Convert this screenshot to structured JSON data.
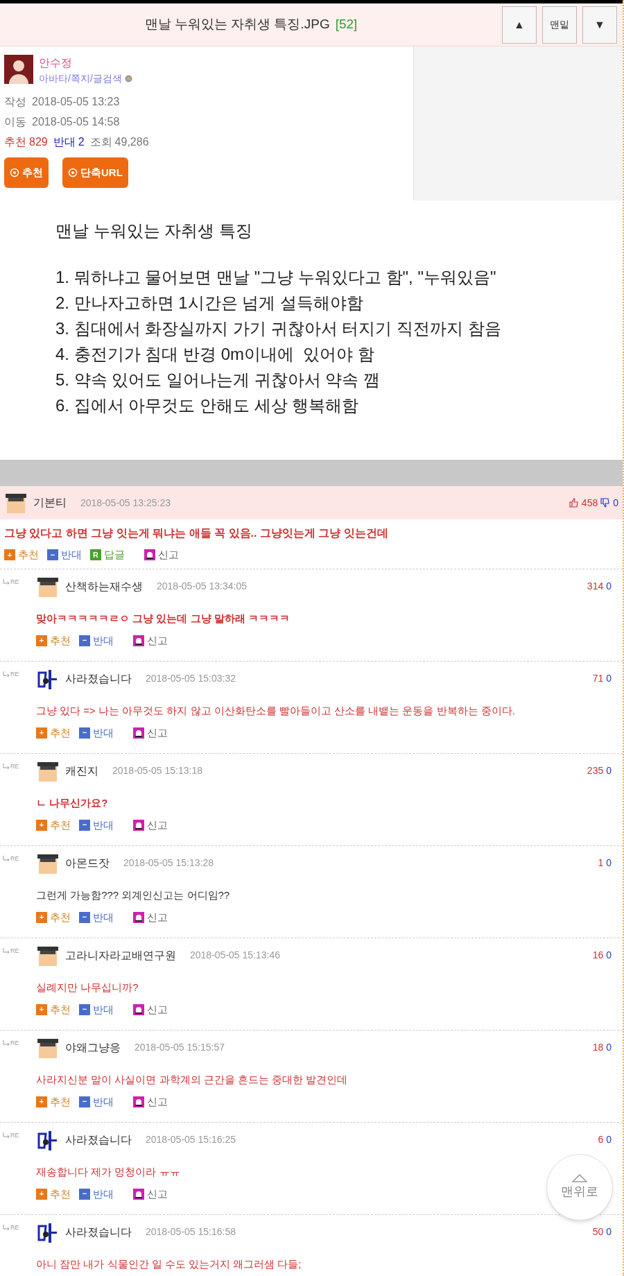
{
  "header": {
    "title": "맨날 누워있는 자취생 특징.JPG",
    "count": "[52]",
    "buttons": [
      {
        "kind": "glyph",
        "label": "▲"
      },
      {
        "kind": "text",
        "label": "맨밑"
      },
      {
        "kind": "glyph",
        "label": "▼"
      }
    ]
  },
  "post": {
    "author": "안수정",
    "author_links": "아바타/쪽지/글검색",
    "meta": [
      {
        "label": "작성",
        "value": "2018-05-05 13:23"
      },
      {
        "label": "이동",
        "value": "2018-05-05 14:58"
      }
    ],
    "stats": [
      {
        "kind": "up",
        "label": "추천",
        "value": "829"
      },
      {
        "kind": "down",
        "label": "반대",
        "value": "2"
      },
      {
        "kind": "plain",
        "label": "조회",
        "value": "49,286"
      }
    ],
    "buttons": [
      "추천",
      "단축URL"
    ],
    "body_title": "맨날 누워있는 자취생 특징",
    "body_lines": [
      "1. 뭐하냐고 물어보면 맨날 \"그냥 누워있다고 함\", \"누워있음\"",
      "2. 만나자고하면 1시간은 넘게 설득해야함",
      "3. 침대에서 화장실까지 가기 귀찮아서 터지기 직전까지 참음",
      "4. 충전기가 침대 반경 0m이내에  있어야 함",
      "5. 약속 있어도 일어나는게 귀찮아서 약속 깸",
      "6. 집에서 아무것도 안해도 세상 행복해함"
    ]
  },
  "best_comment": {
    "user": "기본티",
    "avatar": {
      "kind": "pixel"
    },
    "time": "2018-05-05 13:25:23",
    "up": "458",
    "down": "0",
    "text": "그냥 있다고 하면 그냥 잇는게 뭐냐는 애들 꼭 있음.. 그냥잇는게 그냥 잇는건데",
    "kind": "bold",
    "actions": [
      {
        "kind": "recommend",
        "glyph": "+",
        "label": "추천"
      },
      {
        "kind": "oppose",
        "glyph": "−",
        "label": "반대"
      },
      {
        "kind": "reply",
        "glyph": "R",
        "label": "답글"
      },
      {
        "kind": "report",
        "label": "신고"
      }
    ]
  },
  "replies": [
    {
      "marker": "RE",
      "user": "산책하는재수생",
      "avatar": {
        "kind": "pixel"
      },
      "time": "2018-05-05 13:34:05",
      "up": "314",
      "down": "0",
      "text": "맞아ㅋㅋㅋㅋㅋㄹㅇ 그냥 있는데 그냥 말하래 ㅋㅋㅋㅋ",
      "kind": "bold",
      "actions": [
        {
          "kind": "recommend",
          "glyph": "+",
          "label": "추천"
        },
        {
          "kind": "oppose",
          "glyph": "−",
          "label": "반대"
        },
        {
          "kind": "report",
          "label": "신고"
        }
      ]
    },
    {
      "marker": "RE",
      "user": "사라졌습니다",
      "avatar": {
        "kind": "emblem"
      },
      "time": "2018-05-05 15:03:32",
      "up": "71",
      "down": "0",
      "text": "그냥 있다 => 나는 아무것도 하지 않고 이산화탄소를 빨아들이고 산소를 내뱉는 운동을 반복하는 중이다.",
      "kind": "normal",
      "actions": [
        {
          "kind": "recommend",
          "glyph": "+",
          "label": "추천"
        },
        {
          "kind": "oppose",
          "glyph": "−",
          "label": "반대"
        },
        {
          "kind": "report",
          "label": "신고"
        }
      ]
    },
    {
      "marker": "RE",
      "user": "캐진지",
      "avatar": {
        "kind": "pixel"
      },
      "time": "2018-05-05 15:13:18",
      "up": "235",
      "down": "0",
      "text": "ㄴ 나무신가요?",
      "kind": "bold",
      "actions": [
        {
          "kind": "recommend",
          "glyph": "+",
          "label": "추천"
        },
        {
          "kind": "oppose",
          "glyph": "−",
          "label": "반대"
        },
        {
          "kind": "report",
          "label": "신고"
        }
      ]
    },
    {
      "marker": "RE",
      "user": "아몬드잣",
      "avatar": {
        "kind": "pixel"
      },
      "time": "2018-05-05 15:13:28",
      "up": "1",
      "down": "0",
      "text": "그런게 가능함??? 외계인신고는 어디임??",
      "kind": "plain",
      "actions": [
        {
          "kind": "recommend",
          "glyph": "+",
          "label": "추천"
        },
        {
          "kind": "oppose",
          "glyph": "−",
          "label": "반대"
        },
        {
          "kind": "report",
          "label": "신고"
        }
      ]
    },
    {
      "marker": "RE",
      "user": "고라니자라교배연구원",
      "avatar": {
        "kind": "pixel"
      },
      "time": "2018-05-05 15:13:46",
      "up": "16",
      "down": "0",
      "text": "실례지만 나무십니까?",
      "kind": "normal",
      "actions": [
        {
          "kind": "recommend",
          "glyph": "+",
          "label": "추천"
        },
        {
          "kind": "oppose",
          "glyph": "−",
          "label": "반대"
        },
        {
          "kind": "report",
          "label": "신고"
        }
      ]
    },
    {
      "marker": "RE",
      "user": "야왜그냥응",
      "avatar": {
        "kind": "pixel"
      },
      "time": "2018-05-05 15:15:57",
      "up": "18",
      "down": "0",
      "text": "사라지신분 말이 사실이면 과학계의 근간을 흔드는 중대한 발견인데",
      "kind": "normal",
      "actions": [
        {
          "kind": "recommend",
          "glyph": "+",
          "label": "추천"
        },
        {
          "kind": "oppose",
          "glyph": "−",
          "label": "반대"
        },
        {
          "kind": "report",
          "label": "신고"
        }
      ]
    },
    {
      "marker": "RE",
      "user": "사라졌습니다",
      "avatar": {
        "kind": "emblem"
      },
      "time": "2018-05-05 15:16:25",
      "up": "6",
      "down": "0",
      "text": "재송합니다 제가 멍청이라 ㅠㅠ",
      "kind": "normal",
      "actions": [
        {
          "kind": "recommend",
          "glyph": "+",
          "label": "추천"
        },
        {
          "kind": "oppose",
          "glyph": "−",
          "label": "반대"
        },
        {
          "kind": "report",
          "label": "신고"
        }
      ]
    },
    {
      "marker": "RE",
      "user": "사라졌습니다",
      "avatar": {
        "kind": "emblem"
      },
      "time": "2018-05-05 15:16:58",
      "up": "50",
      "down": "0",
      "text": "아니 잠만 내가 식물인간 일 수도 있는거지 왜그러샘 다들;",
      "kind": "normal"
    }
  ],
  "scroll_top": {
    "label": "맨위로"
  }
}
